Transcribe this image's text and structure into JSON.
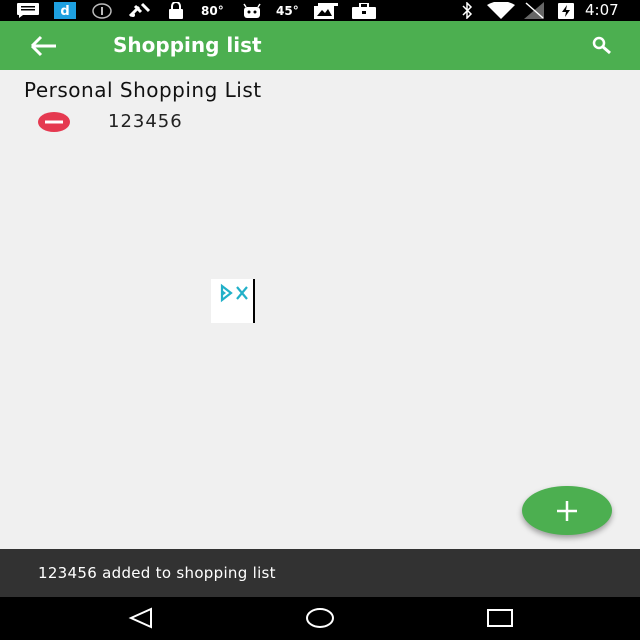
{
  "status_bar": {
    "temp_1": "80°",
    "temp_2": "45°",
    "time": "4:07",
    "icons": [
      "message-icon",
      "d-app-icon",
      "info-icon",
      "satellite-icon",
      "lock-icon",
      "android-icon",
      "photos-icon",
      "briefcase-icon",
      "bluetooth-icon",
      "wifi-icon",
      "no-signal-icon",
      "battery-charging-icon"
    ]
  },
  "toolbar": {
    "title": "Shopping list",
    "back_icon": "arrow-back-icon",
    "search_icon": "search-icon",
    "color": "#4caf50"
  },
  "list": {
    "title": "Personal Shopping List",
    "items": [
      {
        "name": "123456",
        "action_icon": "remove-circle-icon"
      }
    ],
    "remove_color": "#e53950"
  },
  "fab": {
    "icon": "plus-icon"
  },
  "snackbar": {
    "message": "123456 added to shopping list"
  },
  "nav_bar": {
    "icons": [
      "back-triangle-icon",
      "home-circle-icon",
      "recents-square-icon"
    ]
  }
}
